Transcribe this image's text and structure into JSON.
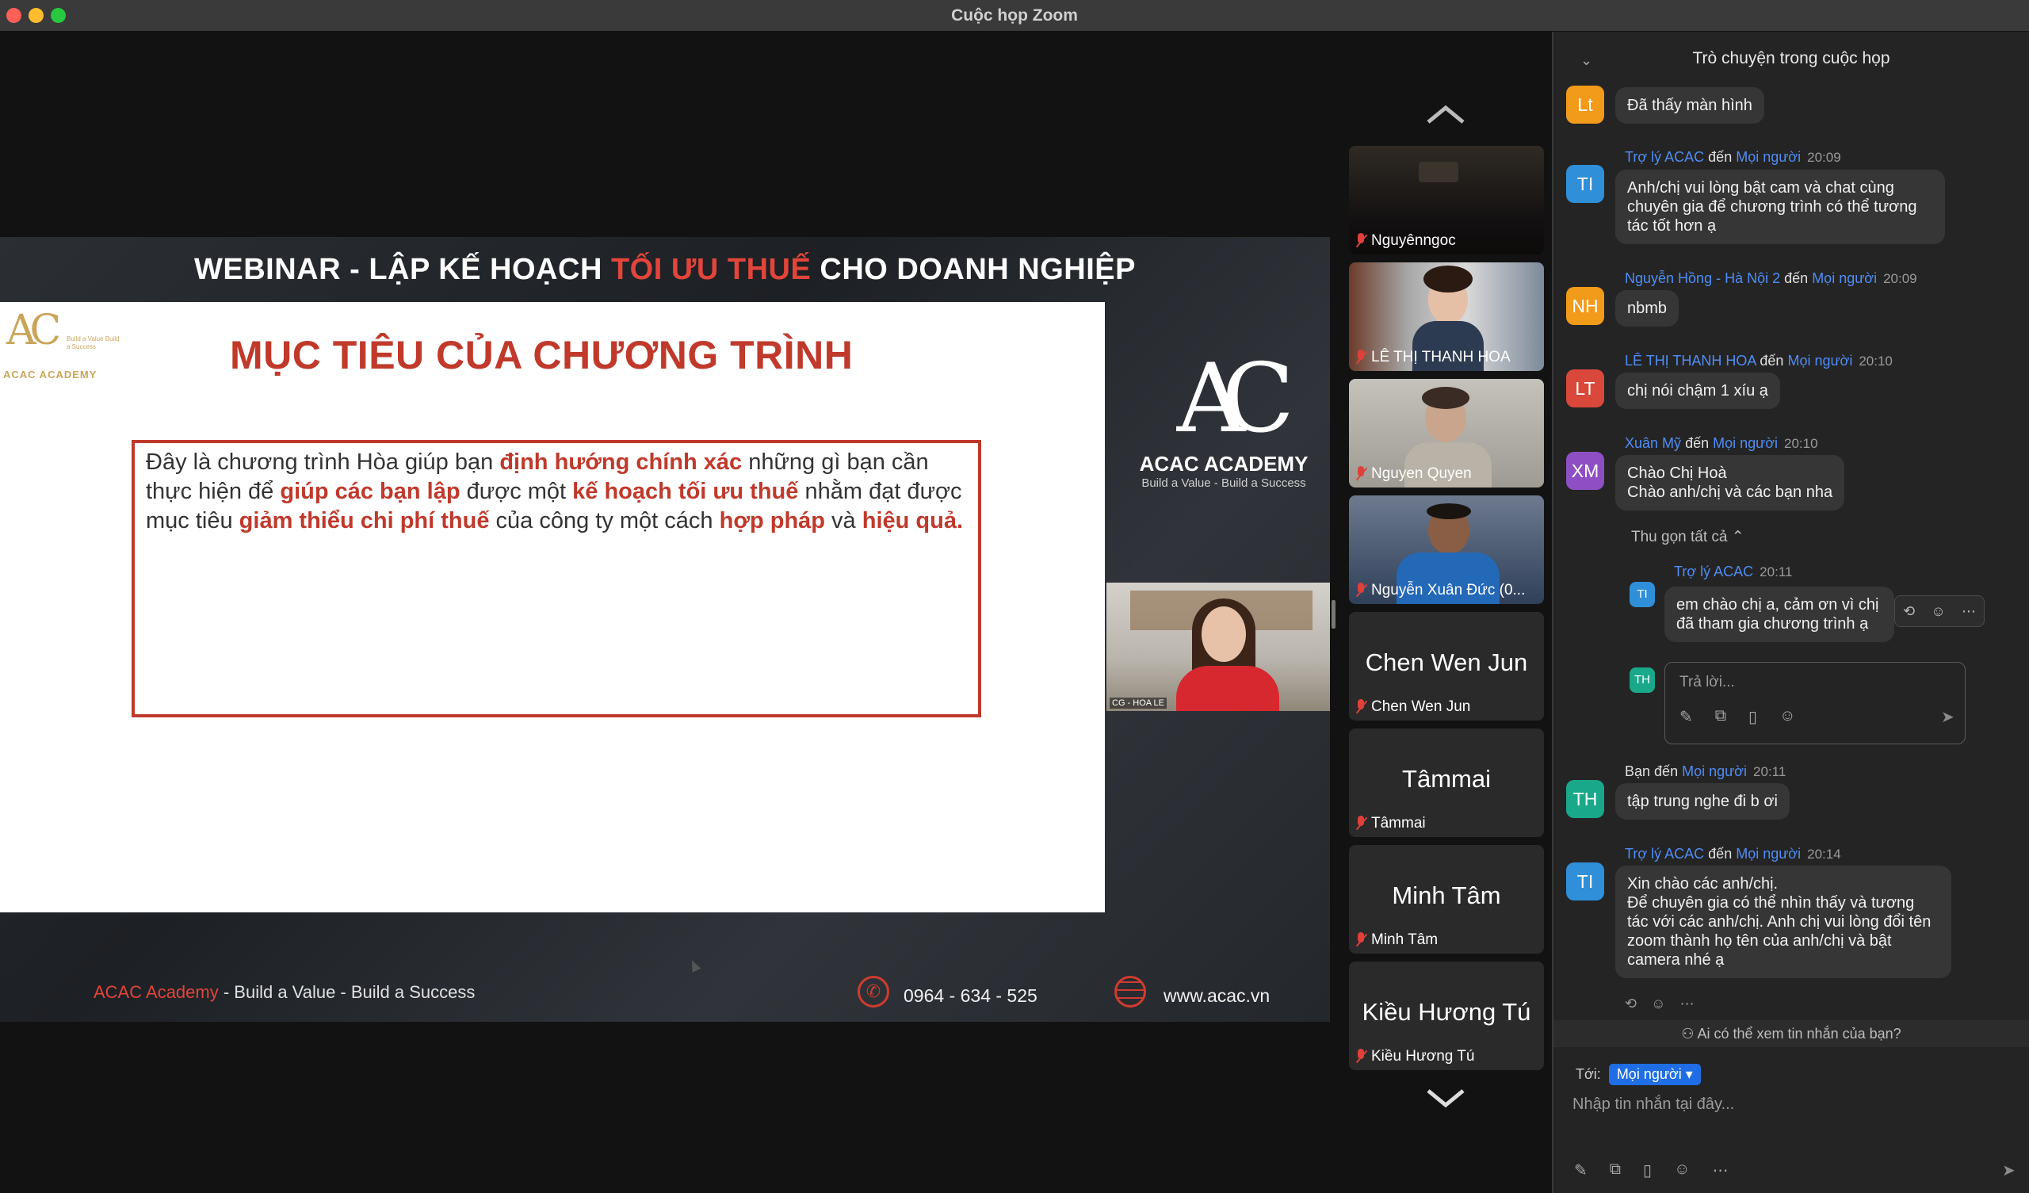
{
  "window": {
    "title": "Cuộc họp Zoom"
  },
  "slide": {
    "banner_pre": "WEBINAR - LẬP KẾ HOẠCH ",
    "banner_hl": "TỐI ƯU THUẾ",
    "banner_post": " CHO DOANH NGHIỆP",
    "mini_logo_text": "ACAC ACADEMY",
    "mini_logo_tag": "Build a Value Build a Success",
    "heading": "MỤC TIÊU CỦA CHƯƠNG TRÌNH",
    "body": [
      {
        "t": "Đây là chương trình Hòa giúp bạn ",
        "r": false
      },
      {
        "t": "định hướng chính xác",
        "r": true
      },
      {
        "t": " những gì bạn cần thực hiện để ",
        "r": false
      },
      {
        "t": "giúp các bạn lập",
        "r": true
      },
      {
        "t": " được một ",
        "r": false
      },
      {
        "t": "kế hoạch tối ưu thuế",
        "r": true
      },
      {
        "t": " nhằm đạt được mục tiêu ",
        "r": false
      },
      {
        "t": "giảm thiểu chi phí thuế",
        "r": true
      },
      {
        "t": " của công ty một cách ",
        "r": false
      },
      {
        "t": "hợp pháp",
        "r": true
      },
      {
        "t": " và ",
        "r": false
      },
      {
        "t": "hiệu quả.",
        "r": true
      }
    ],
    "logo_mark": "AC",
    "logo_name": "ACAC ACADEMY",
    "logo_tag": "Build a Value - Build a Success",
    "presenter_label": "CG - HOA LE",
    "footer_brand": "ACAC Academy",
    "footer_slogan": " - Build a Value - Build a Success",
    "footer_phone": "0964 - 634 - 525",
    "footer_web": "www.acac.vn"
  },
  "participants": [
    {
      "name": "Nguyênngoc",
      "video": true
    },
    {
      "name": "LÊ THỊ THANH HOA",
      "video": true
    },
    {
      "name": "Nguyen Quyen",
      "video": true
    },
    {
      "name": "Nguyễn Xuân Đức (0...",
      "video": true
    },
    {
      "name": "Chen Wen Jun",
      "big": "Chen Wen Jun",
      "video": false
    },
    {
      "name": "Tâmmai",
      "big": "Tâmmai",
      "video": false
    },
    {
      "name": "Minh Tâm",
      "big": "Minh Tâm",
      "video": false
    },
    {
      "name": "Kiều Hương Tú",
      "big": "Kiều Hương Tú",
      "video": false
    }
  ],
  "chat": {
    "title": "Trò chuyện trong cuộc họp",
    "to_word": "đến",
    "messages": [
      {
        "initials": "Lt",
        "color": "#f29a19",
        "sender": "",
        "to": "",
        "time": "",
        "text": "Đã thấy màn hình"
      },
      {
        "initials": "TI",
        "color": "#2f8fd8",
        "sender": "Trợ lý ACAC",
        "to": "Mọi người",
        "time": "20:09",
        "text": "Anh/chị vui lòng bật cam và chat cùng chuyên gia để chương trình có thể tương tác tốt hơn ạ"
      },
      {
        "initials": "NH",
        "color": "#f29a19",
        "sender": "Nguyễn Hồng - Hà Nội 2",
        "to": "Mọi người",
        "time": "20:09",
        "text": "nbmb"
      },
      {
        "initials": "LT",
        "color": "#d9483b",
        "sender": "LÊ THỊ THANH HOA",
        "to": "Mọi người",
        "time": "20:10",
        "text": "chị nói chậm 1 xíu ạ"
      },
      {
        "initials": "XM",
        "color": "#8e4fc4",
        "sender": "Xuân Mỹ",
        "to": "Mọi người",
        "time": "20:10",
        "text": "Chào Chị Hoà\nChào anh/chị và các bạn nha"
      },
      {
        "initials": "TH",
        "color": "#1aa88a",
        "sender": "Bạn",
        "to": "Mọi người",
        "time": "20:11",
        "text": "tập trung nghe đi b ơi"
      },
      {
        "initials": "TI",
        "color": "#2f8fd8",
        "sender": "Trợ lý ACAC",
        "to": "Mọi người",
        "time": "20:14",
        "text": "Xin chào các anh/chị.\nĐể chuyên gia có thể nhìn thấy và tương tác với các anh/chị. Anh chị vui lòng đổi tên zoom thành họ tên của anh/chị và bật camera nhé ạ"
      }
    ],
    "thread": {
      "collapse_label": "Thu gọn tất cả",
      "reply": {
        "initials": "TI",
        "color": "#2f8fd8",
        "sender": "Trợ lý ACAC",
        "time": "20:11",
        "text": "em chào chị a, cảm ơn vì chị đã tham gia chương trình ạ"
      },
      "reply_avatar": "TH",
      "reply_placeholder": "Trả lời..."
    },
    "who_can_see": "Ai có thể xem tin nhắn của bạn?",
    "to_label": "Tới:",
    "to_value": "Mọi người",
    "input_placeholder": "Nhập tin nhắn tại đây..."
  }
}
